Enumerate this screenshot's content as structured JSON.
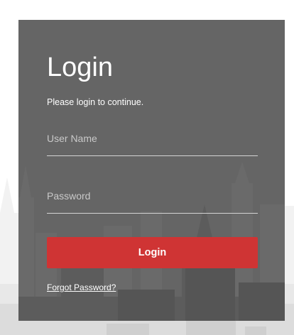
{
  "login_form": {
    "title": "Login",
    "subtitle": "Please login to continue.",
    "username": {
      "placeholder": "User Name",
      "value": ""
    },
    "password": {
      "placeholder": "Password",
      "value": ""
    },
    "submit_label": "Login",
    "forgot_password_label": "Forgot Password?"
  },
  "colors": {
    "panel": "#606060",
    "button": "#cf3434",
    "text": "#ffffff",
    "placeholder": "#c9c9c9",
    "underline": "#d4d4d4"
  }
}
